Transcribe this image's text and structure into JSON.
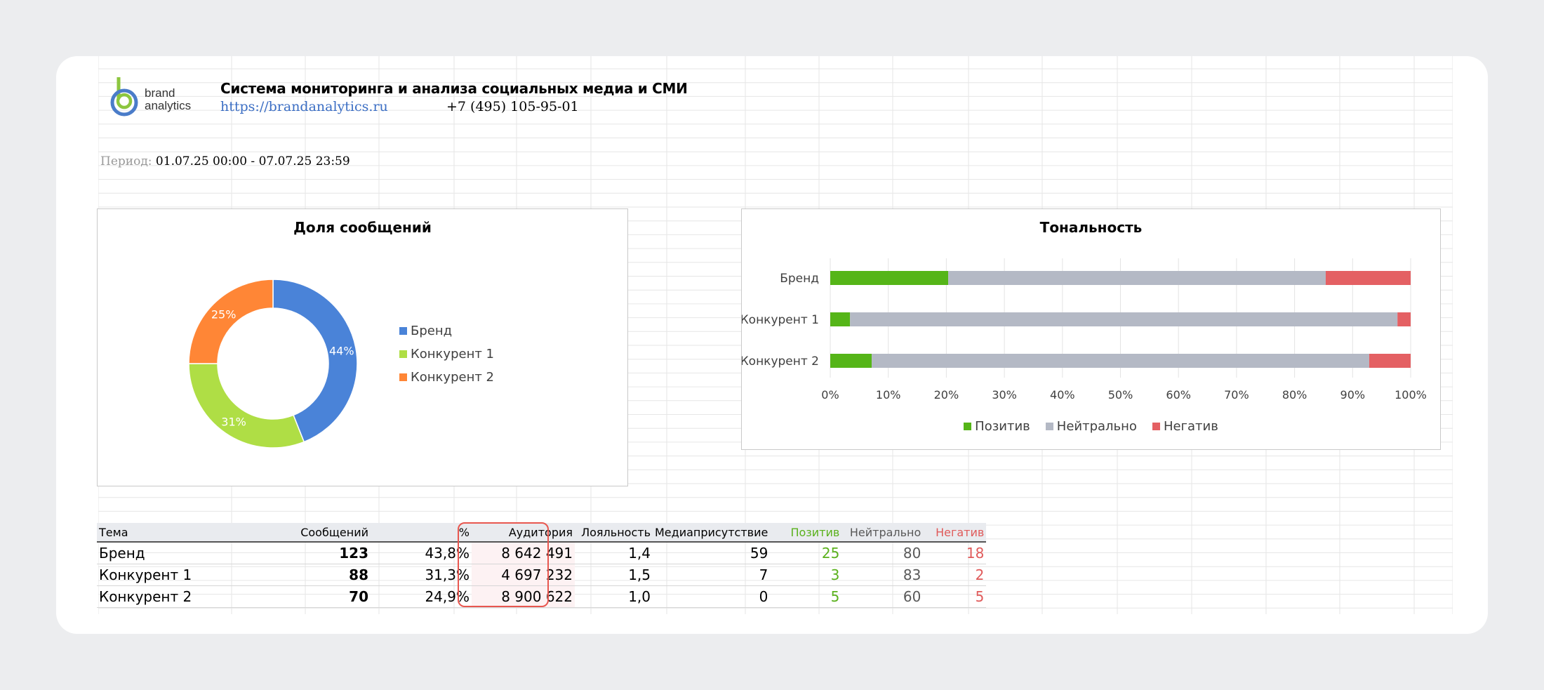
{
  "header": {
    "logo_text_1": "brand",
    "logo_text_2": "analytics",
    "title": "Система мониторинга и анализа социальных медиа и СМИ",
    "url": "https://brandanalytics.ru",
    "phone": "+7 (495) 105-95-01",
    "period_label": "Период:",
    "period_value": " 01.07.25 00:00 - 07.07.25 23:59"
  },
  "colors": {
    "brand": "#4a83d8",
    "competitor1": "#afde45",
    "competitor2": "#ff8636",
    "positive": "#55b518",
    "neutral": "#b4b9c5",
    "negative": "#e46063",
    "highlight": "#e8574f"
  },
  "chart_data": [
    {
      "type": "pie",
      "title": "Доля сообщений",
      "categories": [
        "Бренд",
        "Конкурент 1",
        "Конкурент 2"
      ],
      "values": [
        44,
        31,
        25
      ],
      "data_labels": [
        "44%",
        "31%",
        "25%"
      ],
      "legend": "right"
    },
    {
      "type": "bar",
      "orientation": "horizontal",
      "stacked": "percent",
      "title": "Тональность",
      "categories": [
        "Бренд",
        "Конкурент 1",
        "Конкурент 2"
      ],
      "series": [
        {
          "name": "Позитив",
          "values": [
            25,
            3,
            5
          ]
        },
        {
          "name": "Нейтрально",
          "values": [
            80,
            83,
            60
          ]
        },
        {
          "name": "Негатив",
          "values": [
            18,
            2,
            5
          ]
        }
      ],
      "x_ticks": [
        "0%",
        "10%",
        "20%",
        "30%",
        "40%",
        "50%",
        "60%",
        "70%",
        "80%",
        "90%",
        "100%"
      ],
      "xlim": [
        0,
        100
      ],
      "legend": "bottom",
      "grid": true
    }
  ],
  "table": {
    "headers": [
      "Тема",
      "Сообщений",
      "%",
      "Аудитория",
      "Лояльность",
      "Медиаприсутствие",
      "Позитив",
      "Нейтрально",
      "Негатив"
    ],
    "rows": [
      [
        "Бренд",
        "123",
        "43,8%",
        "8 642 491",
        "1,4",
        "59",
        "25",
        "80",
        "18"
      ],
      [
        "Конкурент 1",
        "88",
        "31,3%",
        "4 697 232",
        "1,5",
        "7",
        "3",
        "83",
        "2"
      ],
      [
        "Конкурент 2",
        "70",
        "24,9%",
        "8 900 622",
        "1,0",
        "0",
        "5",
        "60",
        "5"
      ]
    ]
  }
}
